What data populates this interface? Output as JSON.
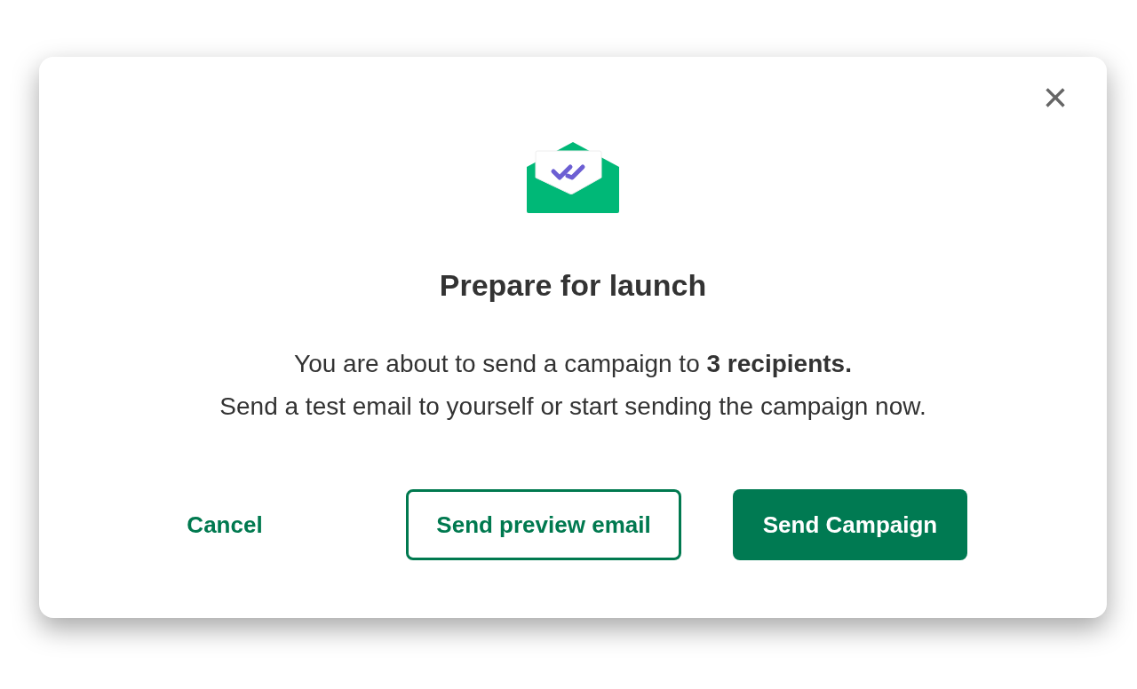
{
  "dialog": {
    "close": "×",
    "title": "Prepare for launch",
    "message": [
      "You are about to send a campaign to **3 recipients.**",
      "Send a test email to yourself or start sending the campaign now."
    ],
    "buttons": [
      {
        "kind": "text",
        "label": "Cancel"
      },
      {
        "kind": "outline",
        "label": "Send preview email"
      },
      {
        "kind": "filled",
        "label": "Send Campaign"
      }
    ]
  }
}
